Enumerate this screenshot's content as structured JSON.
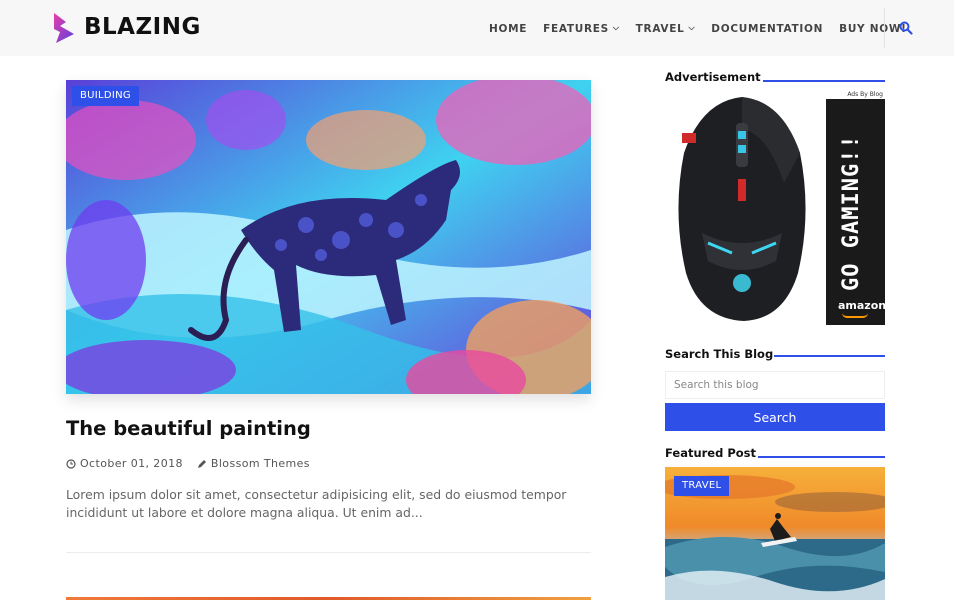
{
  "header": {
    "brand": "BLAZING",
    "nav": [
      {
        "label": "HOME",
        "dropdown": false
      },
      {
        "label": "FEATURES",
        "dropdown": true
      },
      {
        "label": "TRAVEL",
        "dropdown": true
      },
      {
        "label": "DOCUMENTATION",
        "dropdown": false
      },
      {
        "label": "BUY NOW!",
        "dropdown": false
      }
    ]
  },
  "post": {
    "category": "BUILDING",
    "title": "The beautiful painting",
    "date": "October 01, 2018",
    "author": "Blossom Themes",
    "excerpt": "Lorem ipsum dolor sit amet, consectetur adipisicing elit, sed do eiusmod tempor incididunt ut labore et dolore magna aliqua. Ut enim ad..."
  },
  "sidebar": {
    "advertisement": {
      "title": "Advertisement",
      "ad_small_text": "Ads By Blog",
      "ad_banner_text": "GO GAMING!!",
      "ad_banner_brand": "amazon"
    },
    "search": {
      "title": "Search This Blog",
      "placeholder": "Search this blog",
      "button_label": "Search"
    },
    "featured": {
      "title": "Featured Post",
      "category": "TRAVEL"
    }
  },
  "colors": {
    "accent": "#2f50e8",
    "header_bg": "#f7f7f7"
  }
}
